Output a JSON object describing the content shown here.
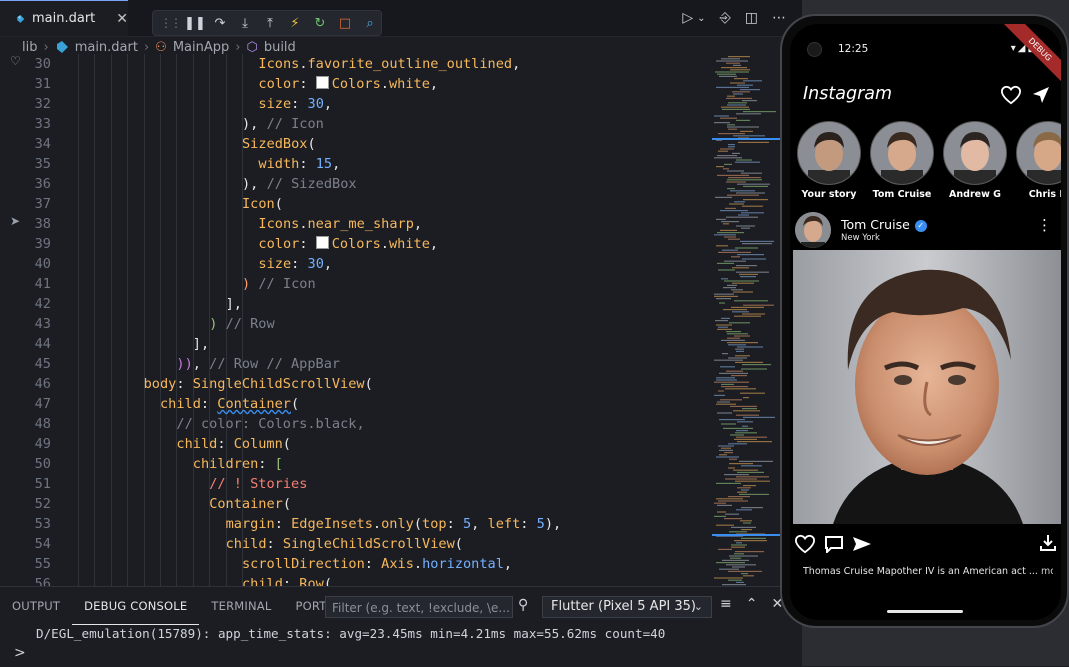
{
  "tab": {
    "filename": "main.dart",
    "close": "✕"
  },
  "breadcrumb": {
    "items": [
      "lib",
      "main.dart",
      "MainApp",
      "build"
    ]
  },
  "code_lines": [
    {
      "n": "30",
      "indent": 11,
      "html": "<span class='k'>Icons</span><span class='w'>.</span><span class='k'>favorite_outline_outlined</span><span class='w'>,</span>"
    },
    {
      "n": "31",
      "indent": 11,
      "html": "<span class='k'>color</span><span class='w'>: </span><span class='swatch'></span><span class='k'>Colors</span><span class='w'>.</span><span class='k'>white</span><span class='w'>,</span>"
    },
    {
      "n": "32",
      "indent": 11,
      "html": "<span class='k'>size</span><span class='w'>: </span><span class='b'>30</span><span class='w'>,</span>"
    },
    {
      "n": "33",
      "indent": 10,
      "html": "<span class='w'>), </span><span class='c'>// Icon</span>"
    },
    {
      "n": "34",
      "indent": 10,
      "html": "<span class='k'>SizedBox</span><span class='w'>(</span>"
    },
    {
      "n": "35",
      "indent": 11,
      "html": "<span class='k'>width</span><span class='w'>: </span><span class='b'>15</span><span class='w'>,</span>"
    },
    {
      "n": "36",
      "indent": 10,
      "html": "<span class='w'>), </span><span class='c'>// SizedBox</span>"
    },
    {
      "n": "37",
      "indent": 10,
      "html": "<span class='k'>Icon</span><span class='w'>(</span>"
    },
    {
      "n": "38",
      "indent": 11,
      "html": "<span class='k'>Icons</span><span class='w'>.</span><span class='k'>near_me_sharp</span><span class='w'>,</span>"
    },
    {
      "n": "39",
      "indent": 11,
      "html": "<span class='k'>color</span><span class='w'>: </span><span class='swatch'></span><span class='k'>Colors</span><span class='w'>.</span><span class='k'>white</span><span class='w'>,</span>"
    },
    {
      "n": "40",
      "indent": 11,
      "html": "<span class='k'>size</span><span class='w'>: </span><span class='b'>30</span><span class='w'>,</span>"
    },
    {
      "n": "41",
      "indent": 10,
      "html": "<span class='o'>)</span><span class='w'> </span><span class='c'>// Icon</span>"
    },
    {
      "n": "42",
      "indent": 9,
      "html": "<span class='w'>],</span>"
    },
    {
      "n": "43",
      "indent": 8,
      "html": "<span class='g'>)</span><span class='w'> </span><span class='c'>// Row</span>"
    },
    {
      "n": "44",
      "indent": 7,
      "html": "<span class='w'>],</span>"
    },
    {
      "n": "45",
      "indent": 6,
      "html": "<span class='p'>))</span><span class='w'>, </span><span class='c'>// Row // AppBar</span>"
    },
    {
      "n": "46",
      "indent": 4,
      "html": "<span class='k'>body</span><span class='w'>: </span><span class='k'>SingleChildScrollView</span><span class='w'>(</span>"
    },
    {
      "n": "47",
      "indent": 5,
      "html": "<span class='k'>child</span><span class='w'>: </span><span class='k' style='text-decoration:underline wavy #3a8ef0;'>Container</span><span class='w'>(</span>"
    },
    {
      "n": "48",
      "indent": 6,
      "html": "<span class='c'>// color: Colors.black,</span>"
    },
    {
      "n": "49",
      "indent": 6,
      "html": "<span class='k'>child</span><span class='w'>: </span><span class='k'>Column</span><span class='w'>(</span>"
    },
    {
      "n": "50",
      "indent": 7,
      "html": "<span class='k'>children</span><span class='w'>: </span><span class='g'>[</span>"
    },
    {
      "n": "51",
      "indent": 8,
      "html": "<span class='r'>// ! Stories</span>"
    },
    {
      "n": "52",
      "indent": 8,
      "html": "<span class='k'>Container</span><span class='w'>(</span>"
    },
    {
      "n": "53",
      "indent": 9,
      "html": "<span class='k'>margin</span><span class='w'>: </span><span class='k'>EdgeInsets</span><span class='w'>.</span><span class='k'>only</span><span class='w'>(</span><span class='k'>top</span><span class='w'>: </span><span class='b'>5</span><span class='w'>, </span><span class='k'>left</span><span class='w'>: </span><span class='b'>5</span><span class='w'>),</span>"
    },
    {
      "n": "54",
      "indent": 9,
      "html": "<span class='k'>child</span><span class='w'>: </span><span class='k'>SingleChildScrollView</span><span class='w'>(</span>"
    },
    {
      "n": "55",
      "indent": 10,
      "html": "<span class='k'>scrollDirection</span><span class='w'>: </span><span class='k'>Axis</span><span class='w'>.</span><span class='b'>horizontal</span><span class='w'>,</span>"
    },
    {
      "n": "56",
      "indent": 10,
      "html": "<span class='k'>child</span><span class='w'>: </span><span class='k'>Row</span><span class='w'>(</span>"
    }
  ],
  "panel": {
    "tabs": [
      "OUTPUT",
      "DEBUG CONSOLE",
      "TERMINAL",
      "PORTS"
    ],
    "active_tab": "DEBUG CONSOLE",
    "filter_placeholder": "Filter (e.g. text, !exclude, \\e...",
    "device": "Flutter (Pixel 5 API 35)",
    "log": "D/EGL_emulation(15789): app_time_stats: avg=23.45ms min=4.21ms max=55.62ms count=40",
    "prompt": ">"
  },
  "phone": {
    "status_time": "12:25",
    "debug_banner": "DEBUG",
    "app_title": "Instagram",
    "stories": [
      {
        "name": "Your story",
        "skin": "#c49a7e",
        "hair": "#2a211c"
      },
      {
        "name": "Tom Cruise",
        "skin": "#d6a98c",
        "hair": "#3b2a20"
      },
      {
        "name": "Andrew G",
        "skin": "#e2b9a3",
        "hair": "#2c2420"
      },
      {
        "name": "Chris H",
        "skin": "#d7a888",
        "hair": "#8a6a46"
      }
    ],
    "post": {
      "user": "Tom Cruise",
      "location": "New York",
      "caption": "Thomas Cruise Mapother IV is an American act ...",
      "more": "more"
    }
  },
  "colors": {
    "accent": "#3a8ef0",
    "debug_ribbon": "#a52a2a",
    "editor_bg": "#1b1d23"
  },
  "icons": [
    "dart-icon",
    "pause-icon",
    "step-over-icon",
    "step-into-icon",
    "step-out-icon",
    "hot-reload-icon",
    "restart-icon",
    "stop-icon",
    "devtools-icon",
    "run-icon",
    "heart-icon",
    "send-icon",
    "like-icon",
    "comment-icon",
    "share-icon",
    "download-icon"
  ]
}
